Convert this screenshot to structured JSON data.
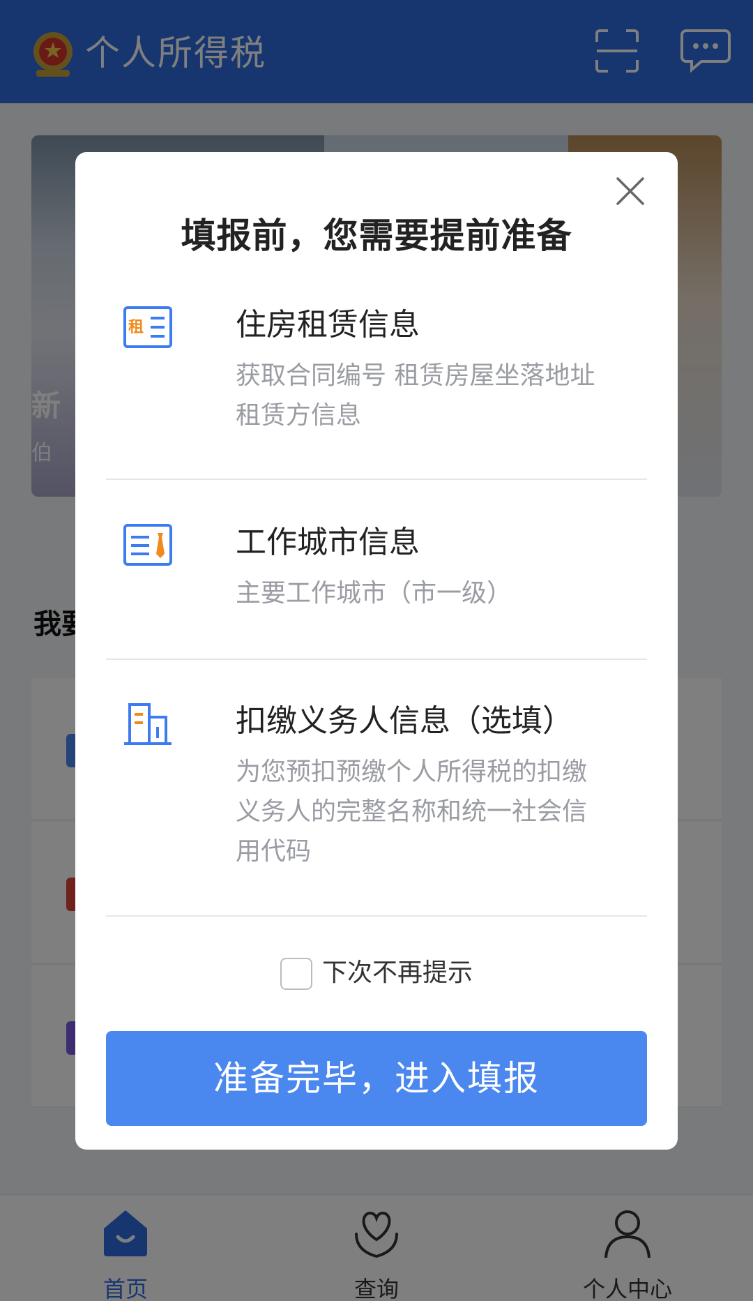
{
  "header": {
    "title": "个人所得税",
    "logo_icon": "national-emblem-icon",
    "scan_icon": "scan-icon",
    "message_icon": "message-icon"
  },
  "background": {
    "banner_title": "新",
    "banner_subtitle": "伯",
    "section_title": "我要"
  },
  "modal": {
    "title": "填报前，您需要提前准备",
    "close_icon": "close-icon",
    "items": [
      {
        "icon": "rental-icon",
        "icon_text": "租",
        "title": "住房租赁信息",
        "desc_lines": [
          "获取合同编号 租赁房屋坐落地址",
          "租赁方信息"
        ]
      },
      {
        "icon": "work-city-icon",
        "title": "工作城市信息",
        "desc_lines": [
          "主要工作城市（市一级）"
        ]
      },
      {
        "icon": "building-icon",
        "title": "扣缴义务人信息（选填）",
        "desc_lines": [
          "为您预扣预缴个人所得税的扣缴",
          "义务人的完整名称和统一社会信",
          "用代码"
        ]
      }
    ],
    "checkbox_label": "下次不再提示",
    "checkbox_checked": false,
    "confirm_button": "准备完毕，进入填报"
  },
  "tabbar": {
    "tabs": [
      {
        "label": "首页",
        "icon": "home-icon",
        "active": true
      },
      {
        "label": "查询",
        "icon": "heart-hand-icon",
        "active": false
      },
      {
        "label": "个人中心",
        "icon": "person-icon",
        "active": false
      }
    ]
  },
  "colors": {
    "brand": "#2f6ddf",
    "button": "#4a87ef",
    "icon_blue": "#3d7cf0",
    "icon_orange": "#f08a1c"
  }
}
